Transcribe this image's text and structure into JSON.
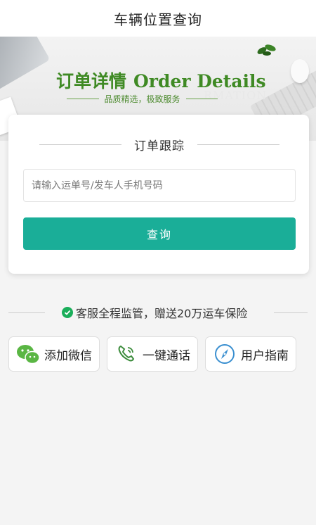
{
  "header": {
    "title": "车辆位置查询"
  },
  "banner": {
    "headline_cn": "订单详情",
    "headline_en": "Order Details",
    "subline": "品质精选，极致服务",
    "watermark": "RMATION"
  },
  "tracking_card": {
    "title": "订单跟踪",
    "input_placeholder": "请输入运单号/发车人手机号码",
    "input_value": "",
    "query_button_label": "查询",
    "button_color": "#1aae98"
  },
  "promise": {
    "text": "客服全程监管，赠送20万运车保险",
    "icon": "check-circle-icon",
    "icon_color": "#1aae5a"
  },
  "actions": [
    {
      "label": "添加微信",
      "icon": "wechat-icon"
    },
    {
      "label": "一键通话",
      "icon": "phone-icon"
    },
    {
      "label": "用户指南",
      "icon": "compass-icon"
    }
  ]
}
